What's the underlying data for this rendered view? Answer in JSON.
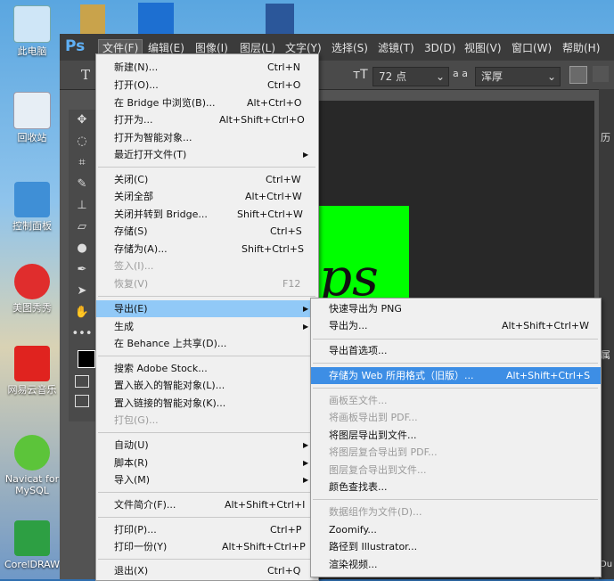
{
  "desktop": {
    "icons": [
      {
        "label": "此电脑"
      },
      {
        "label": "回收站"
      },
      {
        "label": "控制面板"
      },
      {
        "label": "美图秀秀"
      },
      {
        "label": "网易云音乐"
      },
      {
        "label": "Navicat for MySQL"
      },
      {
        "label": "CorelDRAW"
      }
    ]
  },
  "photoshop": {
    "logo": "Ps",
    "menus": [
      "文件(F)",
      "编辑(E)",
      "图像(I)",
      "图层(L)",
      "文字(Y)",
      "选择(S)",
      "滤镜(T)",
      "3D(D)",
      "视图(V)",
      "窗口(W)",
      "帮助(H)"
    ],
    "options": {
      "font_size": "72 点",
      "aa_label": "a a",
      "aa_value": "浑厚"
    },
    "canvas_text": "ps",
    "right_panel_labels": [
      "历",
      "属",
      "Du"
    ]
  },
  "file_menu": [
    {
      "label": "新建(N)...",
      "shortcut": "Ctrl+N"
    },
    {
      "label": "打开(O)...",
      "shortcut": "Ctrl+O"
    },
    {
      "label": "在 Bridge 中浏览(B)...",
      "shortcut": "Alt+Ctrl+O"
    },
    {
      "label": "打开为...",
      "shortcut": "Alt+Shift+Ctrl+O"
    },
    {
      "label": "打开为智能对象...",
      "shortcut": ""
    },
    {
      "label": "最近打开文件(T)",
      "shortcut": ""
    },
    {
      "label": "关闭(C)",
      "shortcut": "Ctrl+W"
    },
    {
      "label": "关闭全部",
      "shortcut": "Alt+Ctrl+W"
    },
    {
      "label": "关闭并转到 Bridge...",
      "shortcut": "Shift+Ctrl+W"
    },
    {
      "label": "存储(S)",
      "shortcut": "Ctrl+S"
    },
    {
      "label": "存储为(A)...",
      "shortcut": "Shift+Ctrl+S"
    },
    {
      "label": "签入(I)...",
      "shortcut": ""
    },
    {
      "label": "恢复(V)",
      "shortcut": "F12"
    },
    {
      "label": "导出(E)",
      "shortcut": ""
    },
    {
      "label": "生成",
      "shortcut": ""
    },
    {
      "label": "在 Behance 上共享(D)...",
      "shortcut": ""
    },
    {
      "label": "搜索 Adobe Stock...",
      "shortcut": ""
    },
    {
      "label": "置入嵌入的智能对象(L)...",
      "shortcut": ""
    },
    {
      "label": "置入链接的智能对象(K)...",
      "shortcut": ""
    },
    {
      "label": "打包(G)...",
      "shortcut": ""
    },
    {
      "label": "自动(U)",
      "shortcut": ""
    },
    {
      "label": "脚本(R)",
      "shortcut": ""
    },
    {
      "label": "导入(M)",
      "shortcut": ""
    },
    {
      "label": "文件简介(F)...",
      "shortcut": "Alt+Shift+Ctrl+I"
    },
    {
      "label": "打印(P)...",
      "shortcut": "Ctrl+P"
    },
    {
      "label": "打印一份(Y)",
      "shortcut": "Alt+Shift+Ctrl+P"
    },
    {
      "label": "退出(X)",
      "shortcut": "Ctrl+Q"
    }
  ],
  "export_menu": [
    {
      "label": "快速导出为 PNG",
      "shortcut": ""
    },
    {
      "label": "导出为...",
      "shortcut": "Alt+Shift+Ctrl+W"
    },
    {
      "label": "导出首选项...",
      "shortcut": ""
    },
    {
      "label": "存储为 Web 所用格式（旧版）...",
      "shortcut": "Alt+Shift+Ctrl+S"
    },
    {
      "label": "画板至文件...",
      "shortcut": ""
    },
    {
      "label": "将画板导出到 PDF...",
      "shortcut": ""
    },
    {
      "label": "将图层导出到文件...",
      "shortcut": ""
    },
    {
      "label": "将图层复合导出到 PDF...",
      "shortcut": ""
    },
    {
      "label": "图层复合导出到文件...",
      "shortcut": ""
    },
    {
      "label": "颜色查找表...",
      "shortcut": ""
    },
    {
      "label": "数据组作为文件(D)...",
      "shortcut": ""
    },
    {
      "label": "Zoomify...",
      "shortcut": ""
    },
    {
      "label": "路径到 Illustrator...",
      "shortcut": ""
    },
    {
      "label": "渲染视频...",
      "shortcut": ""
    }
  ]
}
